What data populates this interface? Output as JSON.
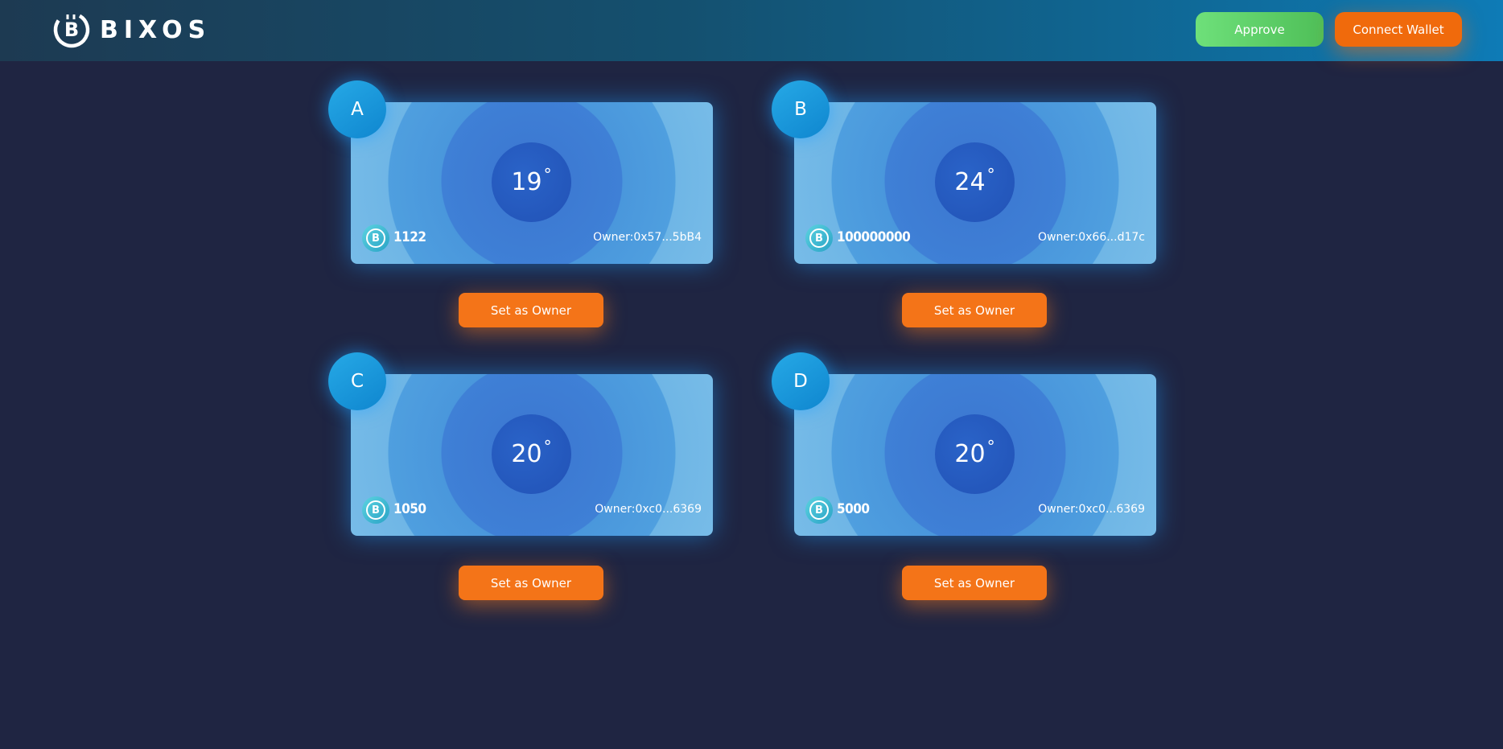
{
  "header": {
    "logo_text": "BIXOS",
    "approve_label": "Approve",
    "connect_label": "Connect Wallet",
    "colors": {
      "approve": "#5fd06a",
      "connect": "#f06a0c"
    }
  },
  "cards": [
    {
      "letter": "A",
      "temperature": "19",
      "degree": "°",
      "amount": "1122",
      "owner": "Owner:0x57...5bB4",
      "button_label": "Set as Owner"
    },
    {
      "letter": "B",
      "temperature": "24",
      "degree": "°",
      "amount": "100000000",
      "owner": "Owner:0x66...d17c",
      "button_label": "Set as Owner"
    },
    {
      "letter": "C",
      "temperature": "20",
      "degree": "°",
      "amount": "1050",
      "owner": "Owner:0xc0...6369",
      "button_label": "Set as Owner"
    },
    {
      "letter": "D",
      "temperature": "20",
      "degree": "°",
      "amount": "5000",
      "owner": "Owner:0xc0...6369",
      "button_label": "Set as Owner"
    }
  ],
  "icons": {
    "logo": "bixos-logo-icon",
    "coin": "bixos-coin-icon"
  }
}
